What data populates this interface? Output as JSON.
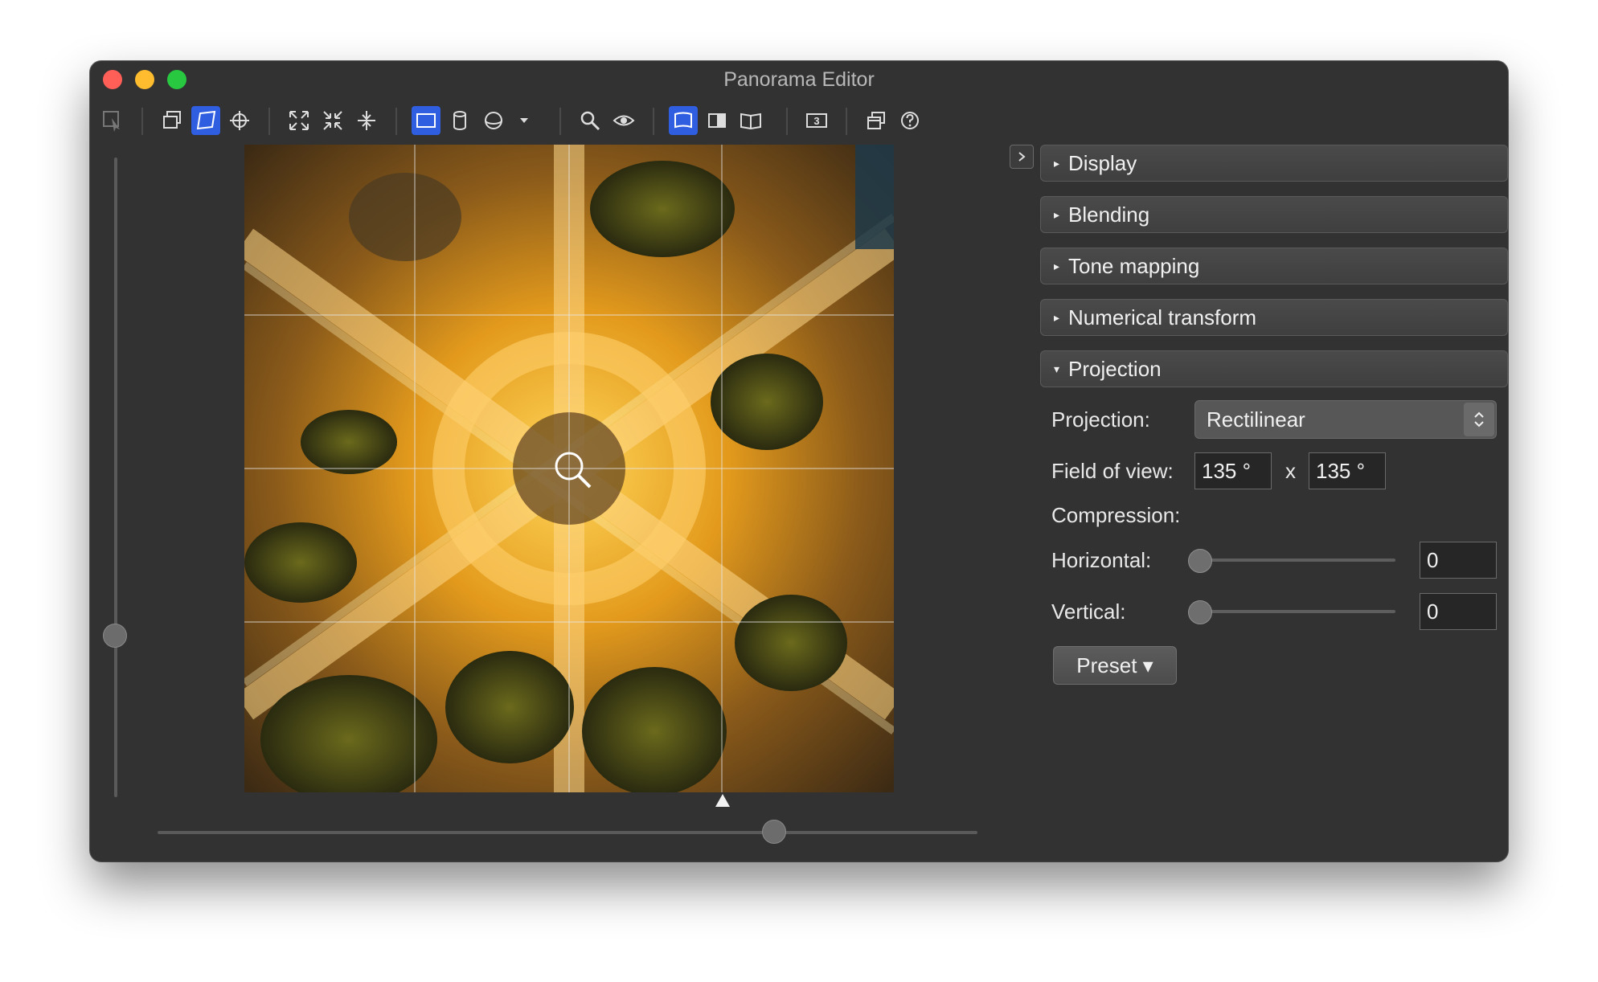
{
  "window": {
    "title": "Panorama Editor"
  },
  "toolbar": {
    "icons": [
      "select-tool-icon",
      "image-layers-icon",
      "warp-icon",
      "crosshair-icon",
      "fit-expand-icon",
      "fit-compress-icon",
      "fit-vertical-icon",
      "rectangle-shape-icon",
      "cylinder-shape-icon",
      "sphere-shape-icon",
      "dropdown-arrow-icon",
      "zoom-icon",
      "eye-icon",
      "flat-view-icon",
      "split-view-icon",
      "book-view-icon",
      "number-3-icon",
      "windows-icon",
      "help-icon"
    ],
    "accent_color": "#2f5ee0"
  },
  "sections": {
    "display": "Display",
    "blending": "Blending",
    "tone_mapping": "Tone mapping",
    "numerical_transform": "Numerical transform",
    "projection": "Projection"
  },
  "projection": {
    "projection_label": "Projection:",
    "projection_value": "Rectilinear",
    "fov_label": "Field of view:",
    "fov_h": "135 °",
    "fov_x": "x",
    "fov_v": "135 °",
    "compression_label": "Compression:",
    "horizontal_label": "Horizontal:",
    "horizontal_value": "0",
    "vertical_label": "Vertical:",
    "vertical_value": "0",
    "preset_label": "Preset ▾"
  }
}
